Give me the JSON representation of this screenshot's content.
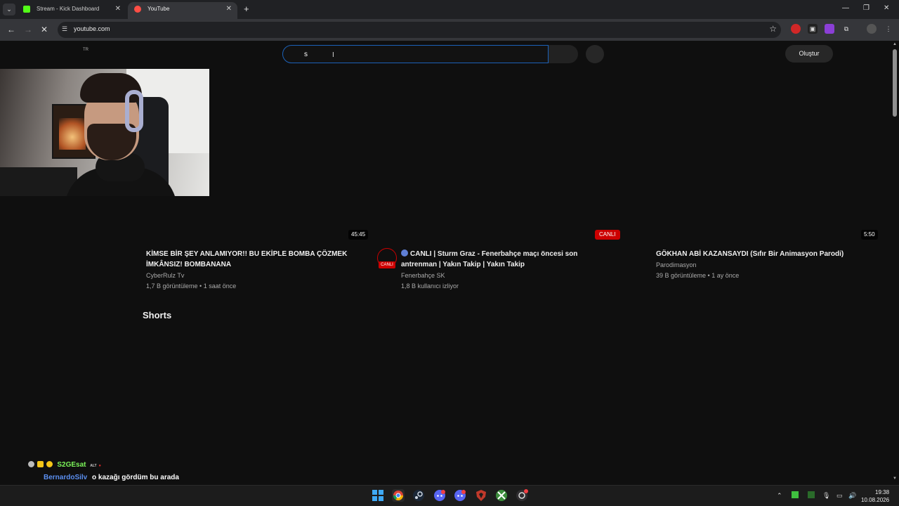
{
  "browser": {
    "tabs": [
      {
        "title": "Stream - Kick Dashboard",
        "favicon_color": "#53fc18",
        "active": false
      },
      {
        "title": "YouTube",
        "favicon_color": "#ff4e45",
        "active": true
      }
    ],
    "url": "youtube.com"
  },
  "youtube": {
    "region": "TR",
    "search_value": "s",
    "create_label": "Oluştur",
    "videos": [
      {
        "title": "KİMSE BİR ŞEY ANLAMIYOR!! BU EKİPLE BOMBA ÇÖZMEK İMKÂNSIZ! BOMBANANA",
        "duration": "45:45",
        "channel": "CyberRulz Tv",
        "meta": "1,7 B görüntüleme • 1 saat önce"
      },
      {
        "title": "CANLI | Sturm Graz - Fenerbahçe maçı öncesi son antrenman | Yakın Takip | Yakın Takip",
        "live_badge": "CANLI",
        "avatar_label": "CANLI",
        "channel": "Fenerbahçe SK",
        "meta": "1,8 B kullanıcı izliyor"
      },
      {
        "title": "GÖKHAN ABİ KAZANSAYDI (Sıfır Bir Animasyon Parodi)",
        "duration": "5:50",
        "channel": "Parodimasyon",
        "meta": "39 B görüntüleme • 1 ay önce"
      }
    ],
    "shorts_title": "Shorts"
  },
  "chat": {
    "messages": [
      {
        "user": "S2GEsat",
        "user_color": "#7cf55a",
        "tag": "ALT",
        "text": ""
      },
      {
        "user": "BernardoSilv",
        "user_color": "#5b8ff0",
        "text": "o kazağı gördüm bu arada"
      }
    ]
  },
  "taskbar": {
    "time": "19:38",
    "date": "10.08.2026"
  },
  "colors": {
    "background": "#0f0f0f",
    "live_red": "#cc0000",
    "focus_blue": "#1c62b9"
  }
}
